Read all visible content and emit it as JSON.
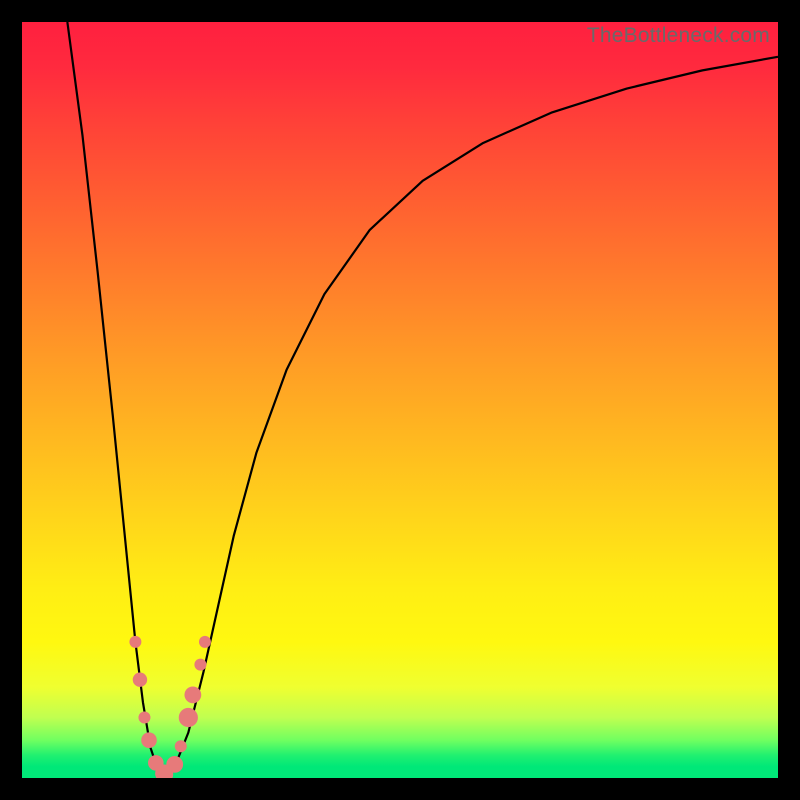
{
  "watermark": "TheBottleneck.com",
  "chart_data": {
    "type": "line",
    "title": "",
    "xlabel": "",
    "ylabel": "",
    "xlim": [
      0,
      100
    ],
    "ylim": [
      0,
      100
    ],
    "series": [
      {
        "name": "bottleneck-curve",
        "x": [
          6,
          8,
          10,
          12,
          14,
          15,
          16,
          17,
          18,
          19,
          20,
          22,
          24,
          26,
          28,
          31,
          35,
          40,
          46,
          53,
          61,
          70,
          80,
          90,
          100
        ],
        "y": [
          100,
          85,
          67,
          48,
          28,
          18,
          10,
          4,
          1,
          0.3,
          1,
          6,
          14,
          23,
          32,
          43,
          54,
          64,
          72.5,
          79,
          84,
          88,
          91.2,
          93.6,
          95.4
        ]
      }
    ],
    "markers": {
      "name": "highlight-dots",
      "color": "#e77a7a",
      "points": [
        {
          "x": 15.0,
          "y": 18.0,
          "r": 1.0
        },
        {
          "x": 15.6,
          "y": 13.0,
          "r": 1.2
        },
        {
          "x": 16.2,
          "y": 8.0,
          "r": 1.0
        },
        {
          "x": 16.8,
          "y": 5.0,
          "r": 1.3
        },
        {
          "x": 17.7,
          "y": 2.0,
          "r": 1.3
        },
        {
          "x": 18.8,
          "y": 0.6,
          "r": 1.5
        },
        {
          "x": 19.2,
          "y": 0.4,
          "r": 1.0
        },
        {
          "x": 20.2,
          "y": 1.8,
          "r": 1.4
        },
        {
          "x": 21.0,
          "y": 4.2,
          "r": 1.0
        },
        {
          "x": 22.0,
          "y": 8.0,
          "r": 1.6
        },
        {
          "x": 22.6,
          "y": 11.0,
          "r": 1.4
        },
        {
          "x": 23.6,
          "y": 15.0,
          "r": 1.0
        },
        {
          "x": 24.2,
          "y": 18.0,
          "r": 1.0
        }
      ]
    }
  }
}
